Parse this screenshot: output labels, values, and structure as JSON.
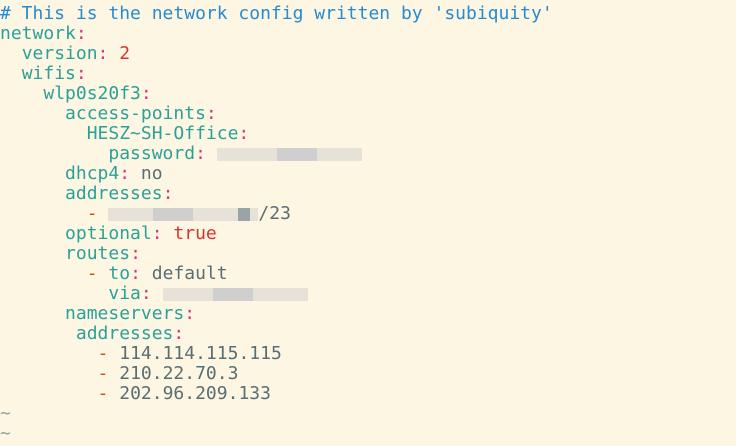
{
  "editor": {
    "comment": "# This is the network config written by 'subiquity'",
    "keys": {
      "network": "network",
      "version": "version",
      "wifis": "wifis",
      "interface": "wlp0s20f3",
      "access_points": "access-points",
      "ssid": "HESZ~SH-Office",
      "password": "password",
      "dhcp4": "dhcp4",
      "addresses": "addresses",
      "optional": "optional",
      "routes": "routes",
      "to": "to",
      "via": "via",
      "nameservers": "nameservers",
      "ns_addresses": "addresses"
    },
    "values": {
      "version": "2",
      "dhcp4": "no",
      "address_suffix": "/23",
      "optional": "true",
      "route_to": "default",
      "nameserver_1": "114.114.115.115",
      "nameserver_2": "210.22.70.3",
      "nameserver_3": "202.96.209.133"
    },
    "punct": {
      "colon": ":",
      "dash": "-"
    },
    "empty_line_marker": "~"
  },
  "colors": {
    "background": "#fdf6e3",
    "comment": "#268bd2",
    "key": "#2aa198",
    "colon": "#d33682",
    "dash": "#cb4b16",
    "number": "#dc322f"
  }
}
